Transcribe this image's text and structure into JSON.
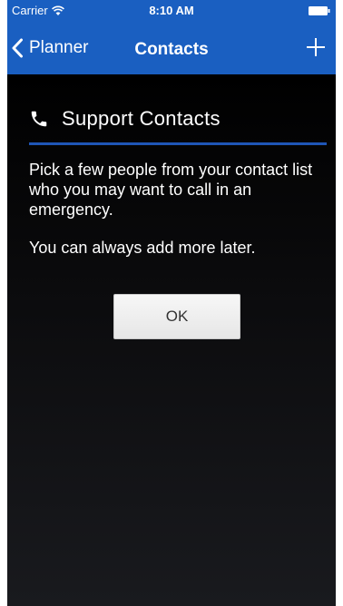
{
  "status_bar": {
    "carrier": "Carrier",
    "time": "8:10 AM",
    "wifi_icon": "wifi-icon",
    "battery_icon": "battery-full-icon"
  },
  "nav_bar": {
    "back_label": "Planner",
    "title": "Contacts",
    "back_icon": "chevron-left-icon",
    "add_icon": "plus-icon",
    "background_color": "#1a5fc1"
  },
  "content": {
    "heading": "Support Contacts",
    "heading_icon": "phone-icon",
    "divider_color": "#1f56b6",
    "paragraph_1": "Pick a few people from your contact list who you may want to call in an emergency.",
    "paragraph_2": "You can always add more later.",
    "ok_label": "OK"
  }
}
